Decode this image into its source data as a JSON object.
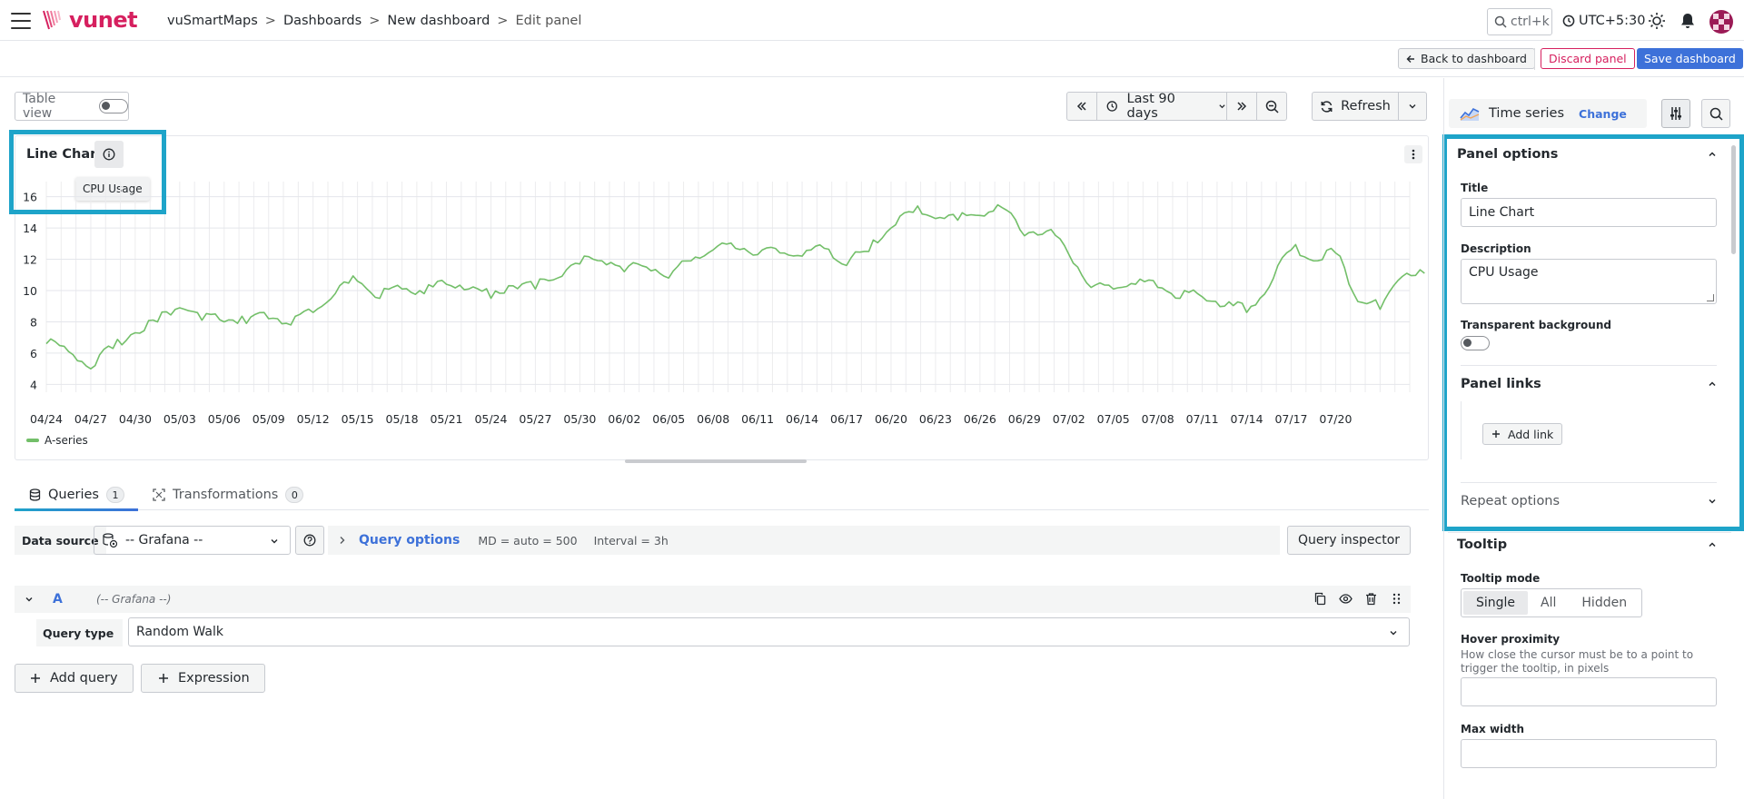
{
  "app": {
    "logo_text": "vunet",
    "brand_color": "#d6205f",
    "accent_color": "#3d71d9",
    "highlight_color": "#1ea4c9"
  },
  "breadcrumb": {
    "items": [
      "vuSmartMaps",
      "Dashboards",
      "New dashboard"
    ],
    "current": "Edit panel",
    "separator": ">"
  },
  "topbar": {
    "search_shortcut": "ctrl+k",
    "timezone": "UTC+5:30",
    "icons": [
      "menu-icon",
      "search-icon",
      "clock-icon",
      "theme-sun-icon",
      "bell-icon",
      "avatar"
    ]
  },
  "toolbar": {
    "back_label": "Back to dashboard",
    "discard_label": "Discard panel",
    "save_label": "Save dashboard"
  },
  "panel_controls": {
    "table_view_label": "Table view",
    "table_view_on": false,
    "time_range": "Last 90 days",
    "refresh_label": "Refresh"
  },
  "panel": {
    "title": "Line Chart",
    "tooltip_text": "CPU Usage"
  },
  "chart_data": {
    "type": "line",
    "title": "Line Chart",
    "x_tick_labels": [
      "04/24",
      "04/27",
      "04/30",
      "05/03",
      "05/06",
      "05/09",
      "05/12",
      "05/15",
      "05/18",
      "05/21",
      "05/24",
      "05/27",
      "05/30",
      "06/02",
      "06/05",
      "06/08",
      "06/11",
      "06/14",
      "06/17",
      "06/20",
      "06/23",
      "06/26",
      "06/29",
      "07/02",
      "07/05",
      "07/08",
      "07/11",
      "07/14",
      "07/17",
      "07/20"
    ],
    "y_ticks": [
      4,
      6,
      8,
      10,
      12,
      14,
      16
    ],
    "ylim": [
      3.5,
      16.5
    ],
    "grid": true,
    "legend_position": "bottom-left",
    "series": [
      {
        "name": "A-series",
        "color": "#73bf69",
        "x_day_offsets": [
          0,
          1.5,
          3,
          4.5,
          6,
          7.5,
          9,
          10.5,
          12,
          13.5,
          15,
          16.5,
          18,
          19.5,
          21,
          22.5,
          24,
          25.5,
          27,
          28.5,
          30,
          31.5,
          33,
          34.5,
          36,
          37.5,
          39,
          40.5,
          42,
          43.5,
          45,
          46.5,
          48,
          49.5,
          51,
          52.5,
          54,
          55.5,
          57,
          58.5,
          60,
          61.5,
          63,
          64.5,
          66,
          67.5,
          69,
          70.5,
          72,
          73.5,
          75,
          76.5,
          78,
          79.5,
          81,
          82.5,
          84,
          85.5,
          87,
          88.5
        ],
        "values": [
          6.6,
          6.1,
          5.0,
          6.3,
          7.3,
          8.0,
          8.9,
          8.1,
          8.0,
          7.9,
          8.2,
          7.8,
          8.6,
          9.8,
          10.6,
          9.5,
          10.1,
          9.8,
          10.4,
          10.1,
          9.5,
          10.3,
          10.1,
          10.8,
          11.7,
          11.9,
          11.2,
          11.5,
          10.8,
          11.9,
          12.6,
          12.7,
          12.3,
          12.4,
          12.2,
          12.7,
          11.6,
          12.5,
          14.0,
          15.0,
          14.6,
          14.5,
          14.8,
          15.3,
          13.5,
          13.8,
          12.3,
          10.2,
          10.1,
          10.4,
          10.2,
          9.5,
          9.6,
          9.0,
          8.6,
          10.2,
          12.6,
          11.9,
          12.4,
          9.3,
          8.8,
          10.9,
          11.1
        ]
      }
    ]
  },
  "query_tabs": [
    {
      "label": "Queries",
      "count": "1",
      "active": true
    },
    {
      "label": "Transformations",
      "count": "0",
      "active": false
    }
  ],
  "query_row": {
    "data_source_label": "Data source",
    "data_source_value": "-- Grafana --",
    "options_title": "Query options",
    "md_text": "MD = auto = 500",
    "interval_text": "Interval = 3h",
    "inspector_label": "Query inspector"
  },
  "query_a": {
    "letter": "A",
    "datasource": "(-- Grafana --)",
    "query_type_label": "Query type",
    "query_type_value": "Random Walk"
  },
  "add_buttons": {
    "add_query": "Add query",
    "expression": "Expression"
  },
  "options_pane": {
    "viz_name": "Time series",
    "change_label": "Change",
    "panel_options": {
      "header": "Panel options",
      "title_label": "Title",
      "title_value": "Line Chart",
      "description_label": "Description",
      "description_value": "CPU Usage",
      "transparent_label": "Transparent background",
      "transparent_on": false
    },
    "panel_links": {
      "header": "Panel links",
      "add_link_label": "Add link"
    },
    "repeat_options": {
      "header": "Repeat options"
    },
    "tooltip": {
      "header": "Tooltip",
      "mode_label": "Tooltip mode",
      "modes": [
        "Single",
        "All",
        "Hidden"
      ],
      "mode_selected": "Single",
      "hover_label": "Hover proximity",
      "hover_desc": "How close the cursor must be to a point to trigger the tooltip, in pixels",
      "hover_value": "",
      "max_width_label": "Max width",
      "max_width_value": ""
    }
  }
}
